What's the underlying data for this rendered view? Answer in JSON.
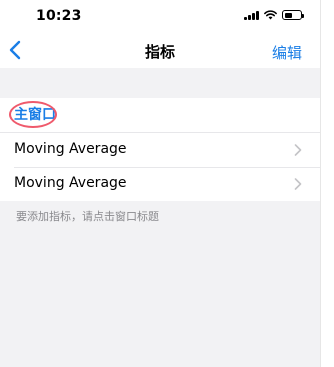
{
  "status_bar": {
    "time": "10:23",
    "battery_fraction": 0.55
  },
  "nav": {
    "title": "指标",
    "edit_label": "编辑"
  },
  "group": {
    "title": "主窗口",
    "items": [
      {
        "label": "Moving Average"
      },
      {
        "label": "Moving Average"
      }
    ]
  },
  "hint": "要添加指标，请点击窗口标题",
  "colors": {
    "accent": "#1a7ee6",
    "highlight": "#ef5a6c",
    "background": "#f2f2f4"
  }
}
